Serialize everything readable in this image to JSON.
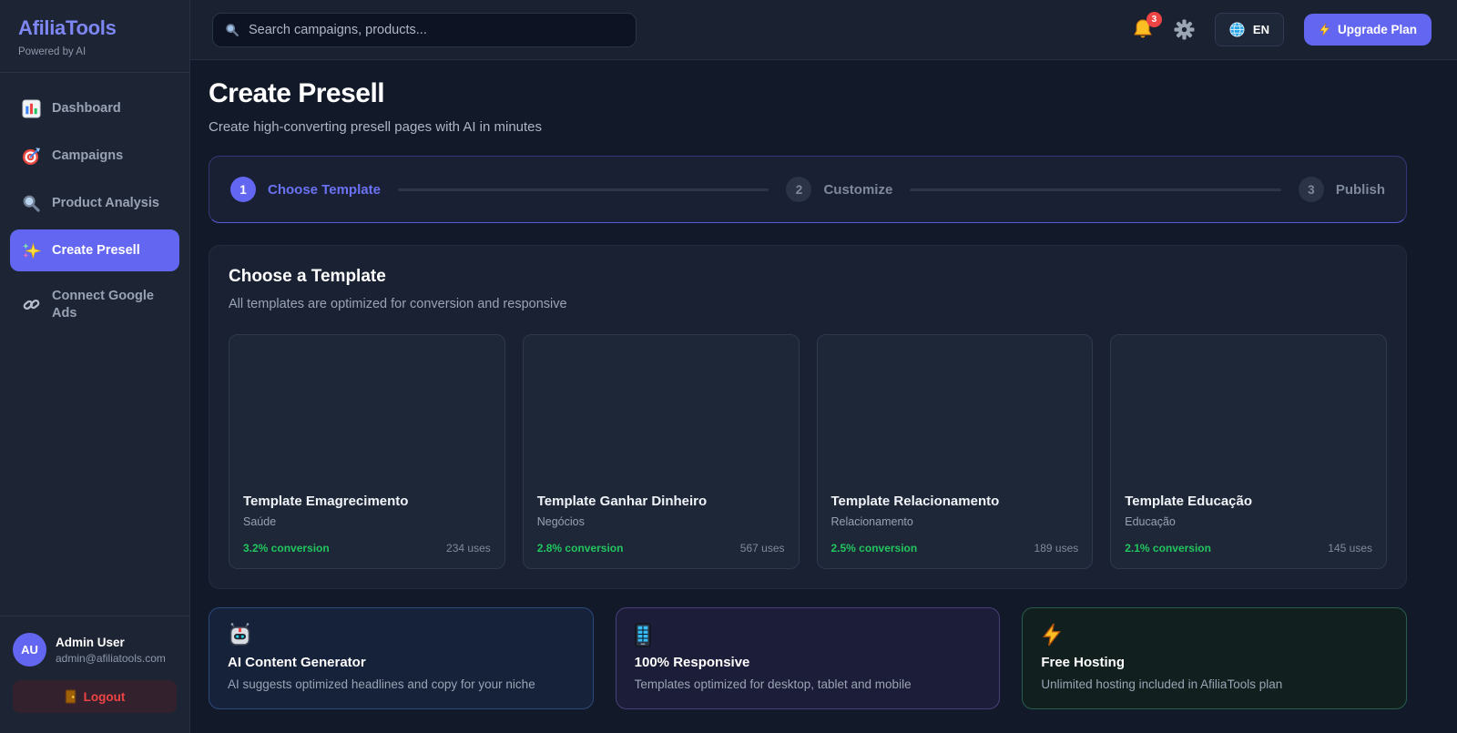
{
  "brand": {
    "name": "AfiliaTools",
    "tagline": "Powered by AI"
  },
  "topbar": {
    "search_placeholder": "Search campaigns, products...",
    "notification_count": "3",
    "language": "EN",
    "upgrade_label": "Upgrade Plan",
    "icons": [
      "search-icon",
      "bell-icon",
      "gear-icon",
      "globe-icon",
      "lightning-icon"
    ]
  },
  "sidebar": {
    "items": [
      {
        "label": "Dashboard",
        "icon": "bar-chart-icon",
        "active": false
      },
      {
        "label": "Campaigns",
        "icon": "target-icon",
        "active": false
      },
      {
        "label": "Product Analysis",
        "icon": "magnifier-icon",
        "active": false
      },
      {
        "label": "Create Presell",
        "icon": "sparkles-icon",
        "active": true
      },
      {
        "label": "Connect Google Ads",
        "icon": "link-icon",
        "active": false
      }
    ],
    "user": {
      "initials": "AU",
      "name": "Admin User",
      "email": "admin@afiliatools.com",
      "logout_label": "Logout",
      "logout_icon": "door-icon"
    }
  },
  "page": {
    "title": "Create Presell",
    "subtitle": "Create high-converting presell pages with AI in minutes"
  },
  "stepper": {
    "steps": [
      {
        "number": "1",
        "label": "Choose Template",
        "state": "active"
      },
      {
        "number": "2",
        "label": "Customize",
        "state": "upcoming"
      },
      {
        "number": "3",
        "label": "Publish",
        "state": "upcoming"
      }
    ]
  },
  "template_section": {
    "title": "Choose a Template",
    "subtitle": "All templates are optimized for conversion and responsive",
    "templates": [
      {
        "name": "Template Emagrecimento",
        "category": "Saúde",
        "conversion": "3.2% conversion",
        "uses": "234 uses"
      },
      {
        "name": "Template Ganhar Dinheiro",
        "category": "Negócios",
        "conversion": "2.8% conversion",
        "uses": "567 uses"
      },
      {
        "name": "Template Relacionamento",
        "category": "Relacionamento",
        "conversion": "2.5% conversion",
        "uses": "189 uses"
      },
      {
        "name": "Template Educação",
        "category": "Educação",
        "conversion": "2.1% conversion",
        "uses": "145 uses"
      }
    ]
  },
  "features": [
    {
      "icon": "robot-icon",
      "title": "AI Content Generator",
      "description": "AI suggests optimized headlines and copy for your niche",
      "accent": "blue"
    },
    {
      "icon": "mobile-phone-icon",
      "title": "100% Responsive",
      "description": "Templates optimized for desktop, tablet and mobile",
      "accent": "purple"
    },
    {
      "icon": "lightning-icon",
      "title": "Free Hosting",
      "description": "Unlimited hosting included in AfiliaTools plan",
      "accent": "green"
    }
  ],
  "colors": {
    "accent": "#6366f1",
    "accent_light": "#7d86f3",
    "success": "#22c55e",
    "danger": "#ef4444",
    "warning": "#fbbf24"
  }
}
